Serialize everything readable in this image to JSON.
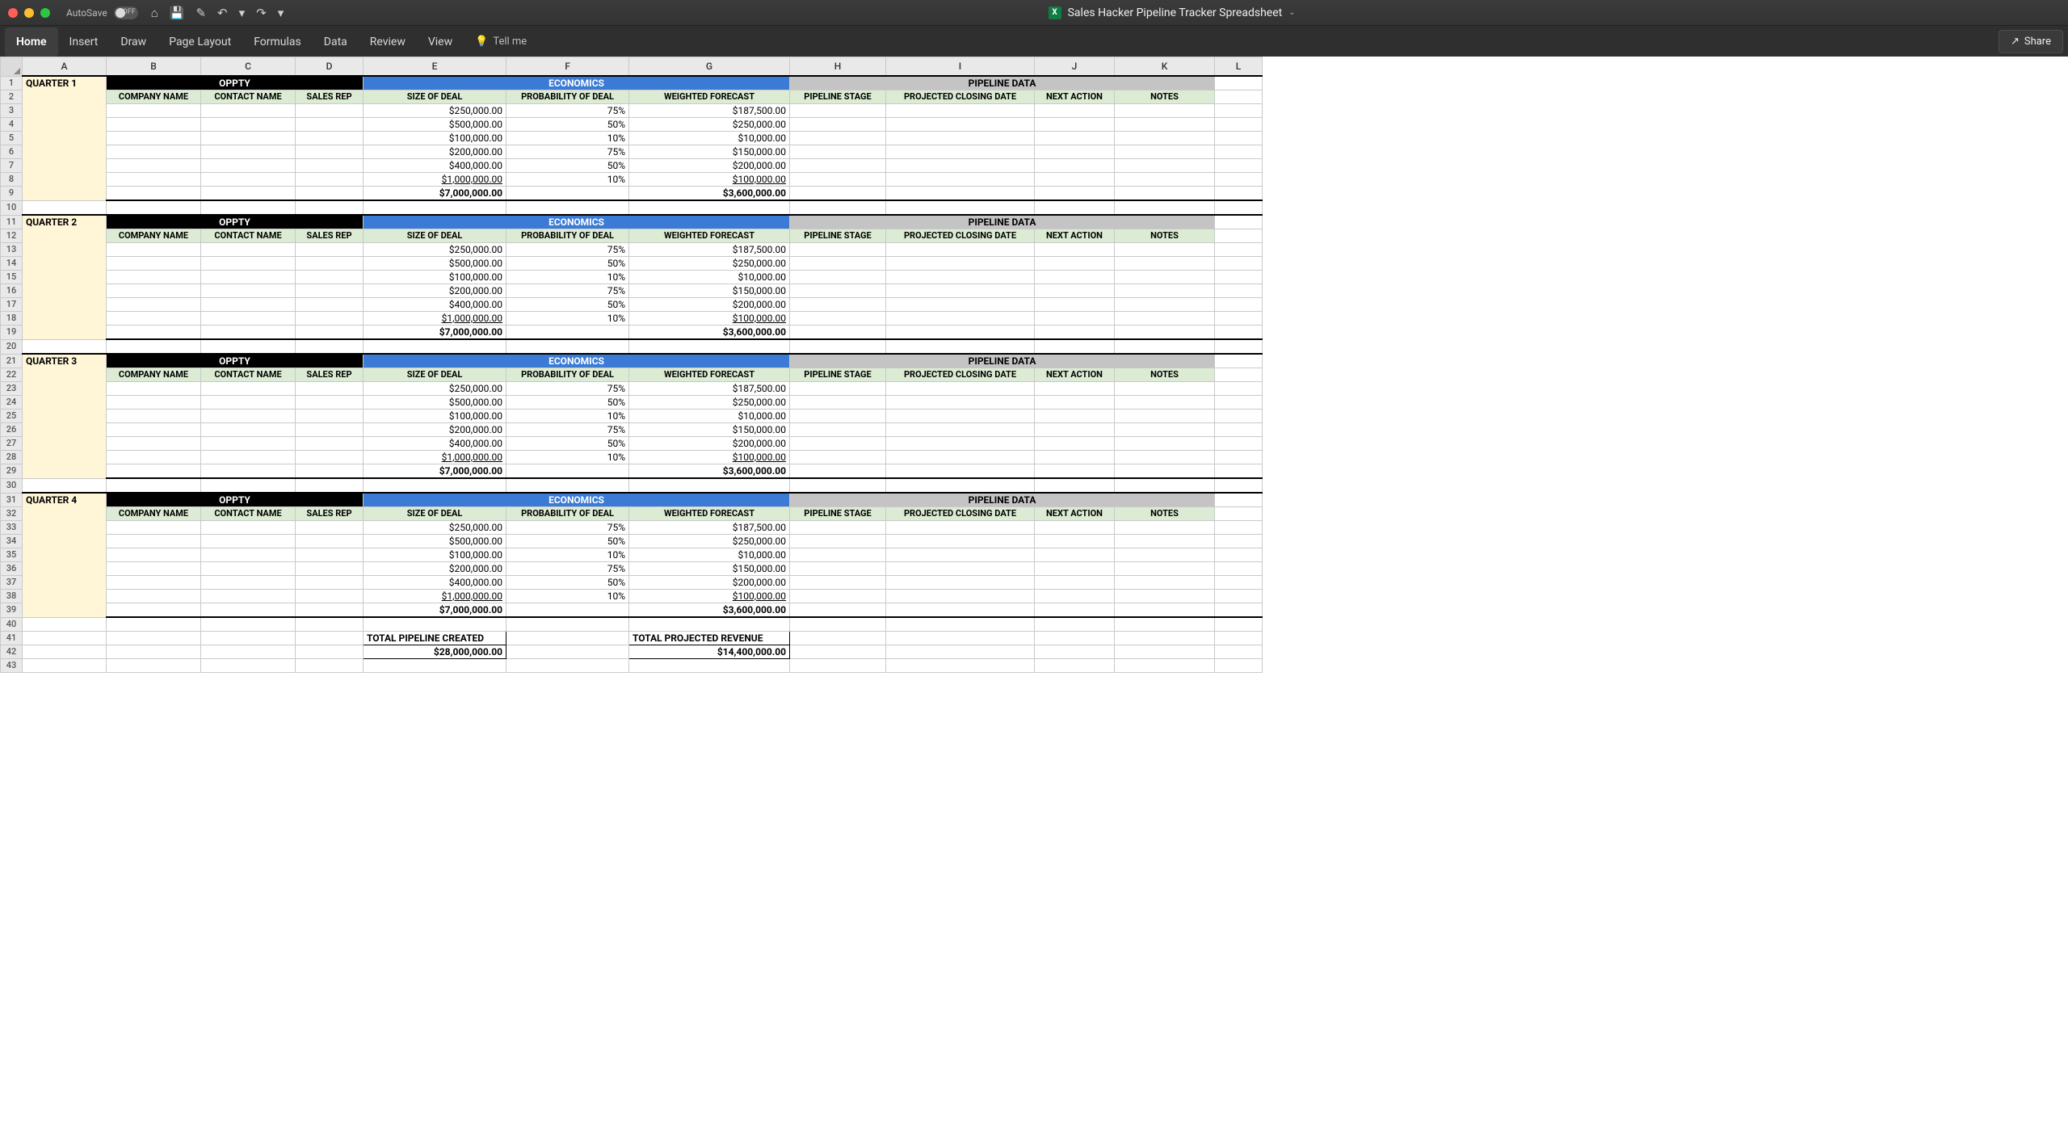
{
  "window": {
    "autosave_label": "AutoSave",
    "autosave_state": "OFF",
    "doc_icon": "X",
    "title": "Sales Hacker Pipeline Tracker Spreadsheet",
    "share": "Share"
  },
  "ribbon": {
    "tabs": [
      "Home",
      "Insert",
      "Draw",
      "Page Layout",
      "Formulas",
      "Data",
      "Review",
      "View"
    ],
    "tellme": "Tell me"
  },
  "columns": [
    "A",
    "B",
    "C",
    "D",
    "E",
    "F",
    "G",
    "H",
    "I",
    "J",
    "K",
    "L"
  ],
  "section_headers": {
    "oppty": "OPPTY",
    "economics": "ECONOMICS",
    "pipeline": "PIPELINE DATA"
  },
  "sub_headers": {
    "company": "COMPANY NAME",
    "contact": "CONTACT NAME",
    "rep": "SALES REP",
    "size": "SIZE OF DEAL",
    "prob": "PROBABILITY OF DEAL",
    "forecast": "WEIGHTED FORECAST",
    "stage": "PIPELINE STAGE",
    "closing": "PROJECTED CLOSING DATE",
    "next": "NEXT ACTION",
    "notes": "NOTES"
  },
  "quarters": [
    {
      "label": "QUARTER 1"
    },
    {
      "label": "QUARTER 2"
    },
    {
      "label": "QUARTER 3"
    },
    {
      "label": "QUARTER 4"
    }
  ],
  "deal_rows": [
    {
      "size": "$250,000.00",
      "prob": "75%",
      "forecast": "$187,500.00"
    },
    {
      "size": "$500,000.00",
      "prob": "50%",
      "forecast": "$250,000.00"
    },
    {
      "size": "$100,000.00",
      "prob": "10%",
      "forecast": "$10,000.00"
    },
    {
      "size": "$200,000.00",
      "prob": "75%",
      "forecast": "$150,000.00"
    },
    {
      "size": "$400,000.00",
      "prob": "50%",
      "forecast": "$200,000.00"
    },
    {
      "size": "$1,000,000.00",
      "prob": "10%",
      "forecast": "$100,000.00"
    }
  ],
  "quarter_total": {
    "size": "$7,000,000.00",
    "forecast": "$3,600,000.00"
  },
  "footer": {
    "pipeline_label": "TOTAL PIPELINE CREATED",
    "pipeline_value": "$28,000,000.00",
    "revenue_label": "TOTAL PROJECTED REVENUE",
    "revenue_value": "$14,400,000.00"
  },
  "row_count": 43
}
